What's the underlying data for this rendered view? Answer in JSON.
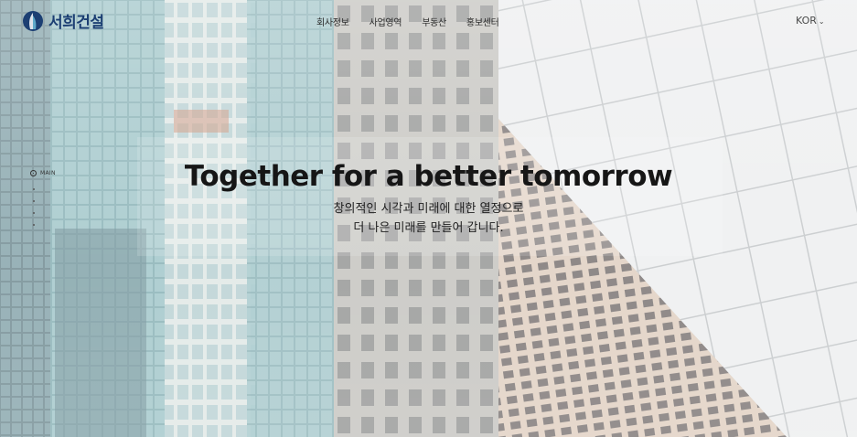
{
  "brand": {
    "name": "서희건설",
    "logo_icon": "logo-emblem-icon",
    "color": "#1c3f73"
  },
  "nav": {
    "items": [
      {
        "label": "회사정보"
      },
      {
        "label": "사업영역"
      },
      {
        "label": "부동산"
      },
      {
        "label": "홍보센터"
      }
    ]
  },
  "language": {
    "label": "KOR",
    "icon": "chevron-down-icon"
  },
  "side_nav": {
    "label": "MAIN",
    "icon": "circle-indicator-icon"
  },
  "hero": {
    "title": "Together for a better tomorrow",
    "subtitle_line1": "창의적인 시각과 미래에 대한 열정으로",
    "subtitle_line2": "더 나은 미래를 만들어 갑니다."
  }
}
